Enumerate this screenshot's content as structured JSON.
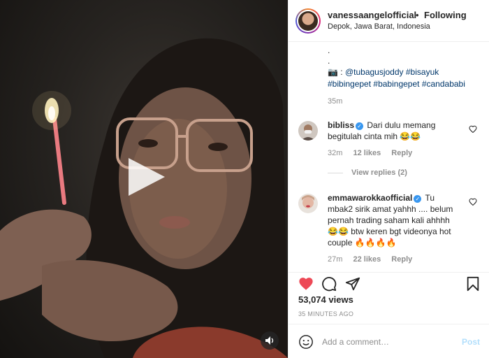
{
  "header": {
    "username": "vanessaangelofficial",
    "separator": "•",
    "follow_status": "Following",
    "location": "Depok, Jawa Barat, Indonesia"
  },
  "caption": {
    "dot1": ".",
    "dot2": ".",
    "prefix": "📷 : ",
    "mention": "@tubagusjoddy",
    "tag1": "#bisayuk",
    "tag2": "#bibingepet",
    "tag3": "#babingepet",
    "tag4": "#candababi",
    "time": "35m"
  },
  "comments": [
    {
      "username": "bibliss",
      "verified": true,
      "text": "Dari dulu memang begitulah cinta mih 😂😂",
      "time": "32m",
      "likes": "12 likes",
      "reply": "Reply",
      "view_replies": "View replies (2)"
    },
    {
      "username": "emmawarokkaofficial",
      "verified": true,
      "text": "Tu mbak2 sirik amat yahhh .... belum pernah trading saham kali ahhhh 😂😂 btw keren bgt videonya hot couple 🔥🔥🔥🔥",
      "time": "27m",
      "likes": "22 likes",
      "reply": "Reply"
    }
  ],
  "stats": {
    "views_count": "53,074",
    "views_label": "views",
    "timestamp": "35 MINUTES AGO"
  },
  "composer": {
    "placeholder": "Add a comment…",
    "post_label": "Post"
  },
  "icons": {
    "like": "heart-icon",
    "comment": "comment-icon",
    "share": "share-icon",
    "save": "bookmark-icon",
    "play": "play-icon",
    "mute": "speaker-icon",
    "emoji": "emoji-icon",
    "verified": "verified-badge-icon"
  },
  "colors": {
    "like_red": "#ed4956",
    "link_blue": "#00376b",
    "verified_blue": "#3897f0",
    "post_disabled": "#b2dffc"
  }
}
